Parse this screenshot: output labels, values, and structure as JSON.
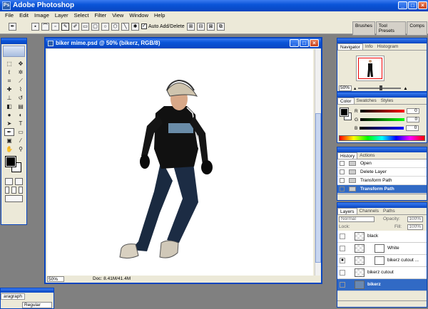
{
  "app": {
    "title": "Adobe Photoshop"
  },
  "menu": [
    "File",
    "Edit",
    "Image",
    "Layer",
    "Select",
    "Filter",
    "View",
    "Window",
    "Help"
  ],
  "options_bar": {
    "auto_add_delete_label": "Auto Add/Delete",
    "auto_add_delete_checked": true,
    "well_tabs": [
      "Brushes",
      "Tool Presets",
      "Comps"
    ]
  },
  "document": {
    "title": "biker mime.psd @ 50% (bikerz, RGB/8)",
    "zoom": "50%",
    "doc_info": "Doc: 8.41M/41.4M"
  },
  "navigator": {
    "tabs": [
      "Navigator",
      "Info",
      "Histogram"
    ],
    "active_tab": "Navigator",
    "zoom": "50%"
  },
  "color_panel": {
    "tabs": [
      "Color",
      "Swatches",
      "Styles"
    ],
    "active_tab": "Color",
    "channels": [
      {
        "label": "R",
        "value": "0",
        "color": "#d01010"
      },
      {
        "label": "G",
        "value": "0",
        "color": "#10a010"
      },
      {
        "label": "B",
        "value": "0",
        "color": "#1020d0"
      }
    ],
    "foreground": "#000000",
    "background": "#ffffff"
  },
  "history": {
    "tabs": [
      "History",
      "Actions"
    ],
    "active_tab": "History",
    "items": [
      "Open",
      "Delete Layer",
      "Transform Path",
      "Transform Path"
    ],
    "selected_index": 3
  },
  "layers": {
    "tabs": [
      "Layers",
      "Channels",
      "Paths"
    ],
    "active_tab": "Layers",
    "blend_mode": "Normal",
    "opacity_label": "Opacity:",
    "opacity": "100%",
    "lock_label": "Lock:",
    "fill_label": "Fill:",
    "fill": "100%",
    "items": [
      {
        "name": "black",
        "visible": false,
        "has_mask": false
      },
      {
        "name": "White",
        "visible": false,
        "has_mask": true
      },
      {
        "name": "bikerz cutout ...",
        "visible": true,
        "has_mask": true
      },
      {
        "name": "bikerz cutout",
        "visible": false,
        "has_mask": false
      },
      {
        "name": "bikerz",
        "visible": false,
        "has_mask": false,
        "selected": true
      }
    ]
  },
  "paragraph_panel": {
    "tab": "aragraph",
    "font_style": "Regular"
  },
  "colors": {
    "titlebar": "#0a55d8",
    "selection": "#316ac5",
    "chrome": "#ece9d8"
  }
}
